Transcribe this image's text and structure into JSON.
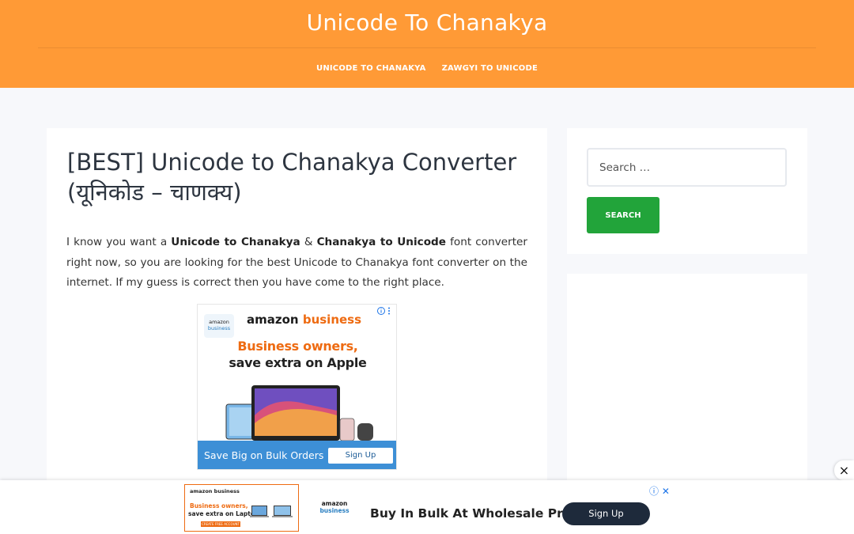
{
  "header": {
    "site_title": "Unicode To Chanakya",
    "nav": [
      "UNICODE TO CHANAKYA",
      "ZAWGYI TO UNICODE"
    ]
  },
  "article": {
    "title": "[BEST] Unicode to Chanakya Converter (यूनिकोड – चाणक्य)",
    "paragraph": {
      "p1": "I know you want a ",
      "b1": "Unicode to Chanakya",
      "p2": " & ",
      "b2": "Chanakya to Unicode",
      "p3": " font converter right now, so you are looking for the best Unicode to Chanakya font converter on the internet. If my guess is correct then you have come to the right place."
    }
  },
  "inline_ad": {
    "logo_line1": "amazon",
    "logo_line2": "business",
    "brand_word1": "amazon",
    "brand_word2": "business",
    "headline_line1": "Business owners,",
    "headline_line2": "save extra on Apple",
    "cta_text": "Save Big on Bulk Orders",
    "cta_button": "Sign Up",
    "adchoices_icon": "info-close-icon"
  },
  "sidebar": {
    "search_placeholder": "Search …",
    "search_button": "SEARCH"
  },
  "close_button": "×",
  "bottom_ad": {
    "thumb_brand": "amazon business",
    "thumb_line1": "Business owners,",
    "thumb_line2": "save extra on Laptops",
    "thumb_cta": "CREATE FREE ACCOUNT",
    "logo_line1": "amazon",
    "logo_line2": "business",
    "headline": "Buy In Bulk At Wholesale Price",
    "signup": "Sign Up",
    "adchoices": "ⓘ ✕"
  },
  "colors": {
    "header": "#ff9a36",
    "search_button": "#22a43a",
    "amazon_orange": "#ee6b12",
    "cta_blue": "#3d8fd6"
  }
}
